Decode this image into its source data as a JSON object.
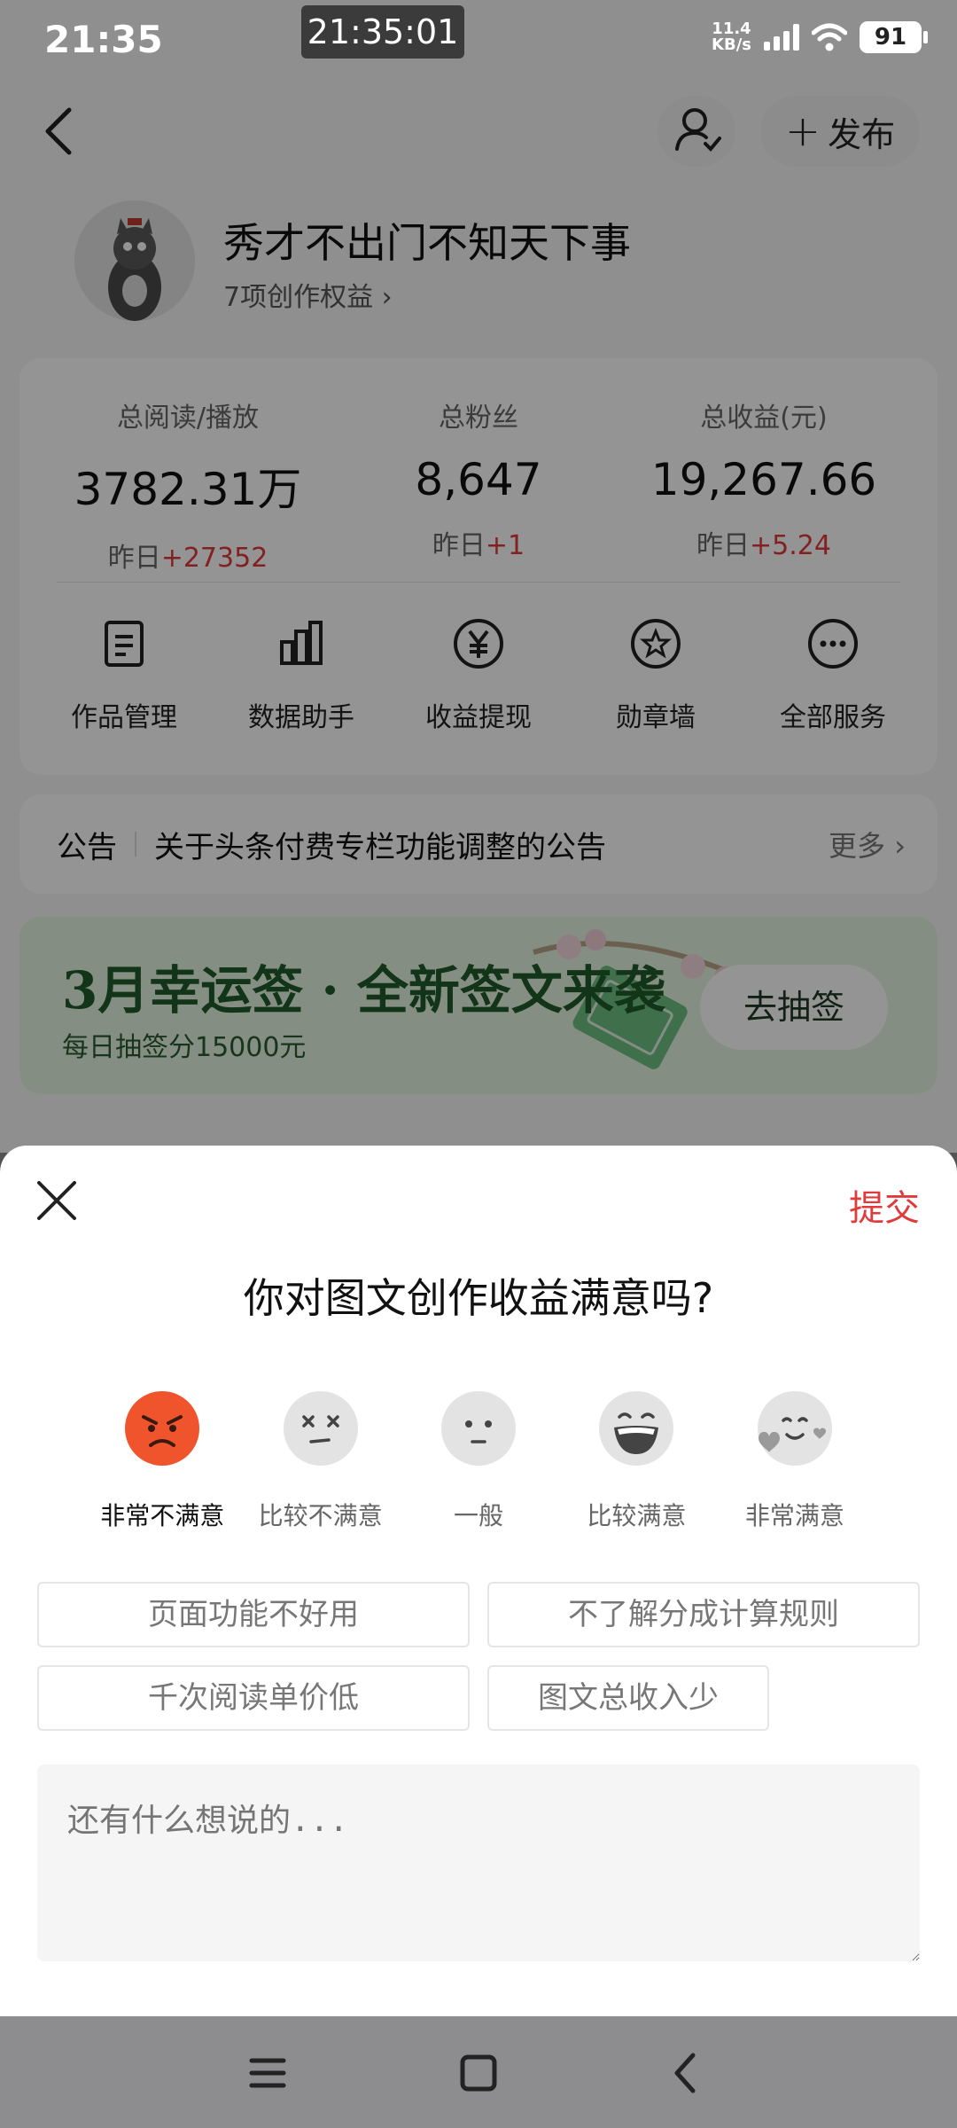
{
  "status_bar": {
    "time": "21:35",
    "center_clock": "21:35:01",
    "net_speed_value": "11.4",
    "net_speed_unit": "KB/s",
    "battery": "91"
  },
  "top_nav": {
    "publish_label": "发布"
  },
  "profile": {
    "username": "秀才不出门不知天下事",
    "benefits": "7项创作权益 ›"
  },
  "stats": [
    {
      "label": "总阅读/播放",
      "value": "3782.31万",
      "delta_prefix": "昨日",
      "delta": "+27352"
    },
    {
      "label": "总粉丝",
      "value": "8,647",
      "delta_prefix": "昨日",
      "delta": "+1"
    },
    {
      "label": "总收益(元)",
      "value": "19,267.66",
      "delta_prefix": "昨日",
      "delta": "+5.24"
    }
  ],
  "services": [
    {
      "label": "作品管理",
      "icon": "document-icon"
    },
    {
      "label": "数据助手",
      "icon": "bar-chart-icon"
    },
    {
      "label": "收益提现",
      "icon": "yen-icon"
    },
    {
      "label": "勋章墙",
      "icon": "badge-icon"
    },
    {
      "label": "全部服务",
      "icon": "more-icon"
    }
  ],
  "notice": {
    "tag": "公告",
    "text": "关于头条付费专栏功能调整的公告",
    "more": "更多 ›"
  },
  "banner": {
    "title": "3月幸运签 · 全新签文来袭",
    "subtitle": "每日抽签分15000元",
    "button": "去抽签"
  },
  "sheet": {
    "submit": "提交",
    "question": "你对图文创作收益满意吗?",
    "ratings": [
      {
        "label": "非常不满意",
        "icon": "angry-face-icon"
      },
      {
        "label": "比较不满意",
        "icon": "dizzy-face-icon"
      },
      {
        "label": "一般",
        "icon": "neutral-face-icon"
      },
      {
        "label": "比较满意",
        "icon": "grinning-face-icon"
      },
      {
        "label": "非常满意",
        "icon": "love-face-icon"
      }
    ],
    "chips": [
      "页面功能不好用",
      "不了解分成计算规则",
      "千次阅读单价低",
      "图文总收入少"
    ],
    "comment_placeholder": "还有什么想说的..."
  },
  "colors": {
    "accent_red": "#e03a3a",
    "angry_emoji": "#f0542c",
    "banner_green": "#1f5a2a"
  }
}
